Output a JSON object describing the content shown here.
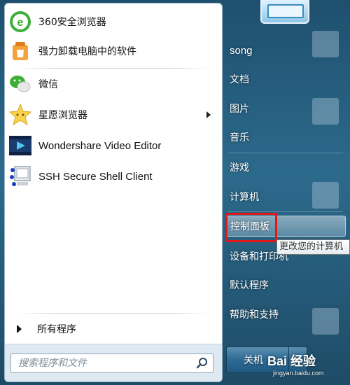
{
  "programs": [
    {
      "label": "360安全浏览器",
      "icon": "browser-360-icon"
    },
    {
      "label": "强力卸载电脑中的软件",
      "icon": "uninstaller-icon"
    },
    {
      "label": "微信",
      "icon": "wechat-icon"
    },
    {
      "label": "星愿浏览器",
      "icon": "twinkstar-browser-icon",
      "has_submenu": true
    },
    {
      "label": "Wondershare Video Editor",
      "icon": "video-editor-icon"
    },
    {
      "label": "SSH Secure Shell Client",
      "icon": "ssh-client-icon"
    }
  ],
  "all_programs_label": "所有程序",
  "search": {
    "placeholder": "搜索程序和文件"
  },
  "right_menu": [
    {
      "label": "song"
    },
    {
      "label": "文档"
    },
    {
      "label": "图片"
    },
    {
      "label": "音乐"
    },
    {
      "label": "游戏"
    },
    {
      "label": "计算机"
    },
    {
      "label": "控制面板",
      "highlighted": true
    },
    {
      "label": "设备和打印机"
    },
    {
      "label": "默认程序"
    },
    {
      "label": "帮助和支持"
    }
  ],
  "tooltip": "更改您的计算机",
  "shutdown": {
    "label": "关机"
  },
  "watermark": {
    "brand": "Bai 经验",
    "url": "jingyan.baidu.com"
  },
  "colors": {
    "highlight_border": "#e01818",
    "pane_bg": "#ffffff",
    "desktop": "#2c6a8c"
  }
}
